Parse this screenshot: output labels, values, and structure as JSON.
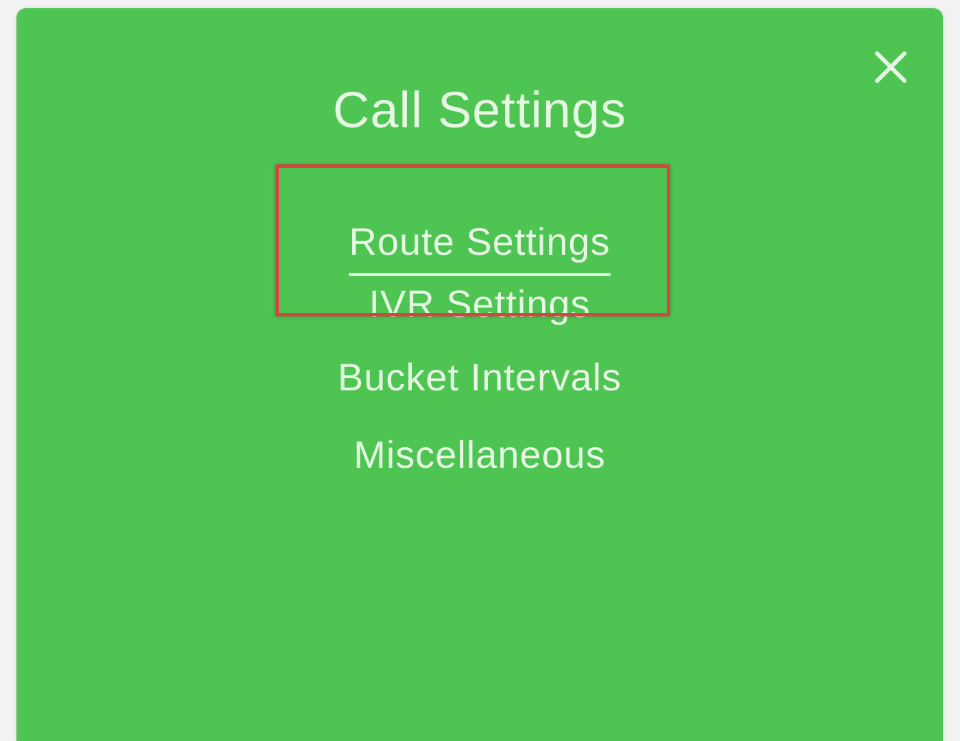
{
  "dialog": {
    "title": "Call Settings",
    "close_icon": "close-icon",
    "background_color": "#4ec452",
    "highlight_color": "#d6453f"
  },
  "menu": {
    "items": [
      {
        "label": "Route Settings",
        "active": true
      },
      {
        "label": "IVR Settings",
        "active": false
      },
      {
        "label": "Bucket Intervals",
        "active": false
      },
      {
        "label": "Miscellaneous",
        "active": false
      }
    ]
  }
}
